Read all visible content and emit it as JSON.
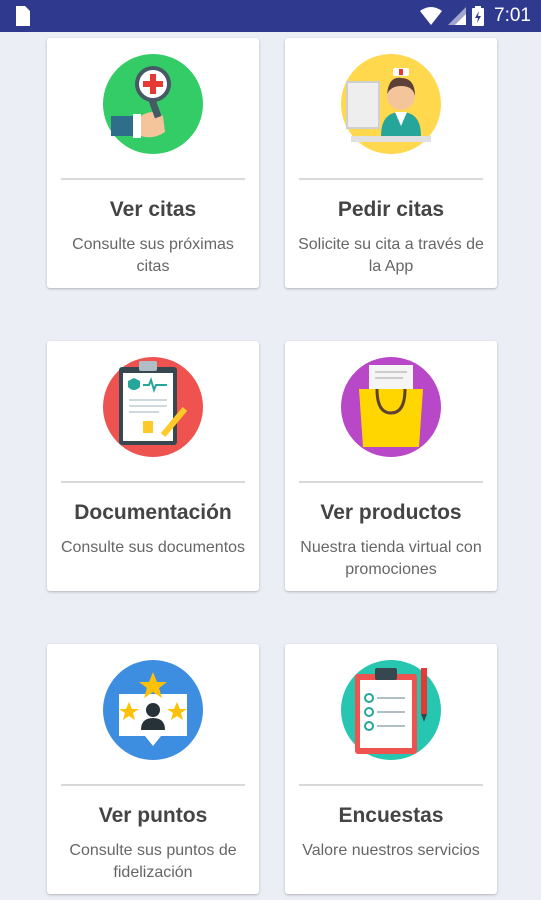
{
  "status_bar": {
    "time": "7:01",
    "icons": [
      "sim-card-icon",
      "wifi-icon",
      "signal-icon",
      "battery-icon"
    ]
  },
  "cards": [
    {
      "title": "Ver citas",
      "description": "Consulte sus próximas citas",
      "icon": "doctor-search-icon",
      "icon_bg": "#33cc66"
    },
    {
      "title": "Pedir citas",
      "description": "Solicite su cita a través de la App",
      "icon": "nurse-icon",
      "icon_bg": "#ffd84d"
    },
    {
      "title": "Documentación",
      "description": "Consulte sus documentos",
      "icon": "medical-document-icon",
      "icon_bg": "#ef5350"
    },
    {
      "title": "Ver productos",
      "description": "Nuestra tienda virtual con promociones",
      "icon": "shopping-bag-icon",
      "icon_bg": "#b848c8"
    },
    {
      "title": "Ver puntos",
      "description": "Consulte sus puntos de fidelización",
      "icon": "loyalty-stars-icon",
      "icon_bg": "#3d8ee0"
    },
    {
      "title": "Encuestas",
      "description": "Valore nuestros servicios",
      "icon": "survey-clipboard-icon",
      "icon_bg": "#26c6b0"
    }
  ]
}
